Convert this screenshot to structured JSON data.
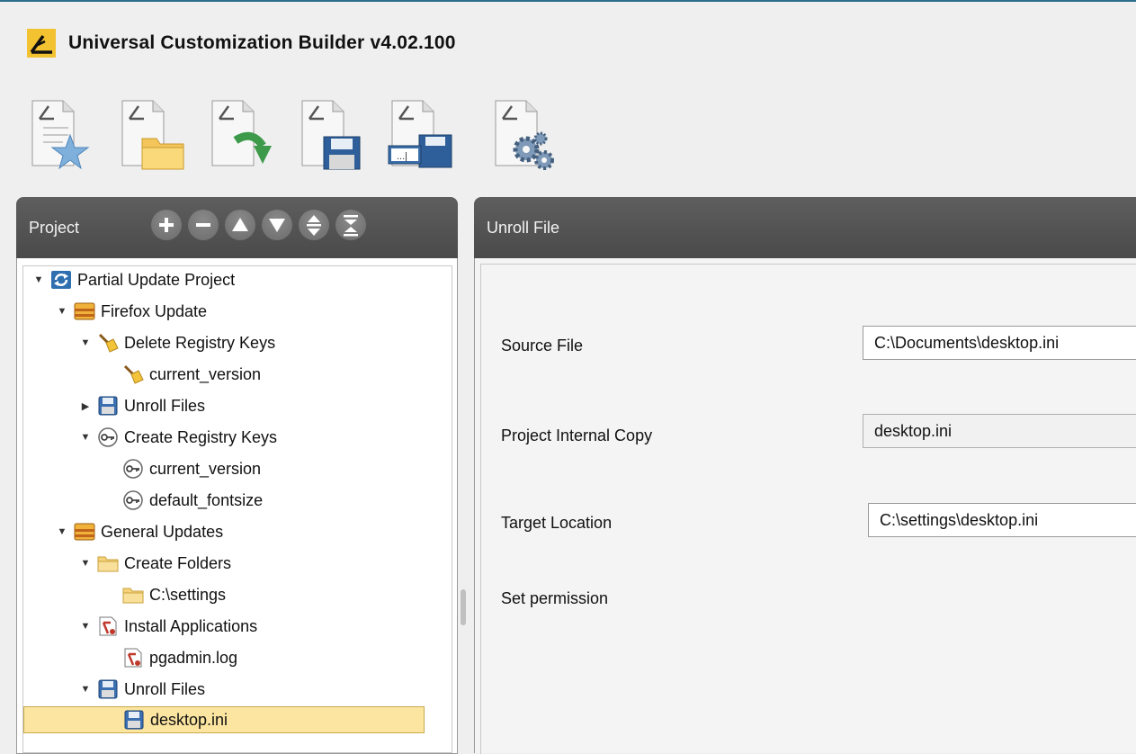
{
  "app": {
    "title": "Universal Customization Builder v4.02.100"
  },
  "toolbar": {
    "buttons": [
      {
        "icon": "new-project-icon"
      },
      {
        "icon": "open-project-icon"
      },
      {
        "icon": "reload-project-icon"
      },
      {
        "icon": "save-project-icon"
      },
      {
        "icon": "save-as-project-icon"
      },
      {
        "icon": "build-settings-icon"
      }
    ]
  },
  "project_panel": {
    "title": "Project",
    "actions": [
      "add",
      "remove",
      "move-up",
      "move-down",
      "expand-all",
      "collapse-all"
    ],
    "tree": [
      {
        "label": "Partial Update Project",
        "level": 0,
        "arrow": "▼",
        "icon": "project-icon"
      },
      {
        "label": "Firefox Update",
        "level": 1,
        "arrow": "▼",
        "icon": "package-icon"
      },
      {
        "label": "Delete Registry Keys",
        "level": 2,
        "arrow": "▼",
        "icon": "broom-icon"
      },
      {
        "label": "current_version",
        "level": 3,
        "arrow": "",
        "icon": "broom-icon"
      },
      {
        "label": "Unroll Files",
        "level": 2,
        "arrow": "▶",
        "icon": "floppy-icon"
      },
      {
        "label": "Create Registry Keys",
        "level": 2,
        "arrow": "▼",
        "icon": "key-icon"
      },
      {
        "label": "current_version",
        "level": 3,
        "arrow": "",
        "icon": "key-icon"
      },
      {
        "label": "default_fontsize",
        "level": 3,
        "arrow": "",
        "icon": "key-icon"
      },
      {
        "label": "General Updates",
        "level": 1,
        "arrow": "▼",
        "icon": "package-icon"
      },
      {
        "label": "Create Folders",
        "level": 2,
        "arrow": "▼",
        "icon": "folder-icon"
      },
      {
        "label": "C:\\settings",
        "level": 3,
        "arrow": "",
        "icon": "folder-icon"
      },
      {
        "label": "Install Applications",
        "level": 2,
        "arrow": "▼",
        "icon": "installer-icon"
      },
      {
        "label": "pgadmin.log",
        "level": 3,
        "arrow": "",
        "icon": "installer-icon"
      },
      {
        "label": "Unroll Files",
        "level": 2,
        "arrow": "▼",
        "icon": "floppy-icon"
      },
      {
        "label": "desktop.ini",
        "level": 3,
        "arrow": "",
        "icon": "floppy-icon",
        "selected": true
      }
    ]
  },
  "detail_panel": {
    "title": "Unroll File",
    "fields": {
      "source_label": "Source File",
      "source_value": "C:\\Documents\\desktop.ini",
      "internal_label": "Project Internal Copy",
      "internal_value": "desktop.ini",
      "target_label": "Target Location",
      "target_value": "C:\\settings\\desktop.ini",
      "permission_label": "Set permission"
    }
  }
}
